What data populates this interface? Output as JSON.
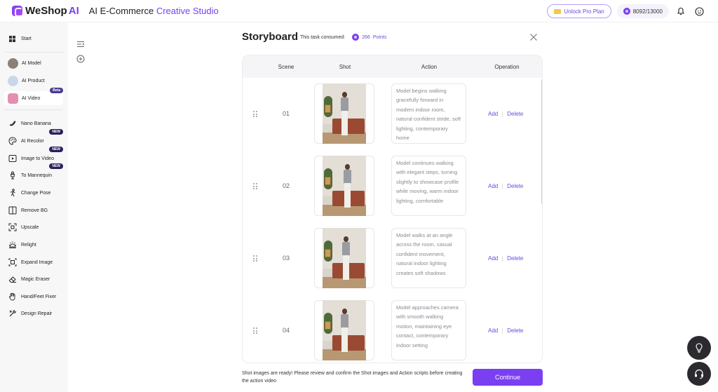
{
  "brand": {
    "name": "WeShop",
    "ai": "AI"
  },
  "app_title": {
    "prefix": "AI E-Commerce",
    "accent": "Creative Studio"
  },
  "top": {
    "unlock_label": "Unlock Pro Plan",
    "points": "8092/13000"
  },
  "sidebar": {
    "start": "Start",
    "items": [
      {
        "label": "AI Model"
      },
      {
        "label": "AI Product"
      },
      {
        "label": "AI Video",
        "badge": "Beta"
      }
    ],
    "tools": [
      {
        "label": "Nano Banana",
        "icon": "banana-icon"
      },
      {
        "label": "AI Recolor",
        "icon": "palette-icon",
        "badge": "NEW"
      },
      {
        "label": "Image to Video",
        "icon": "video-icon",
        "badge": "NEW"
      },
      {
        "label": "To Mannequin",
        "icon": "mannequin-icon",
        "badge": "NEW"
      },
      {
        "label": "Change Pose",
        "icon": "pose-icon"
      },
      {
        "label": "Remove BG",
        "icon": "remove-bg-icon"
      },
      {
        "label": "Upscale",
        "icon": "upscale-icon"
      },
      {
        "label": "Relight",
        "icon": "relight-icon"
      },
      {
        "label": "Expand Image",
        "icon": "expand-icon"
      },
      {
        "label": "Magic Eraser",
        "icon": "eraser-icon"
      },
      {
        "label": "Hand/Feet Fixer",
        "icon": "hand-icon"
      },
      {
        "label": "Design Repair",
        "icon": "repair-icon"
      }
    ]
  },
  "storyboard": {
    "title": "Storyboard",
    "consumed_label": "This task consumed:",
    "consumed_value": "266",
    "consumed_unit": "Points",
    "columns": [
      "Scene",
      "Shot",
      "Action",
      "Operation"
    ],
    "rows": [
      {
        "scene": "01",
        "action": "Model begins walking gracefully forward in modern indoor room, natural confident stride, soft lighting, contemporary home"
      },
      {
        "scene": "02",
        "action": "Model continues walking with elegant steps, turning slightly to showcase profile while moving, warm indoor lighting, comfortable"
      },
      {
        "scene": "03",
        "action": "Model walks at an angle across the room, casual confident movement, natural indoor lighting creates soft shadows"
      },
      {
        "scene": "04",
        "action": "Model approaches camera with smooth walking motion, maintaining eye contact, contemporary indoor setting"
      }
    ],
    "op_add": "Add",
    "op_delete": "Delete"
  },
  "footer": {
    "note": "Shot images are ready! Please review and confirm the Shot images and Action scripts before creating the action video",
    "continue_label": "Continue"
  },
  "colors": {
    "accent": "#7b3ff2",
    "sidebar_bg": "#f7f7f8"
  }
}
